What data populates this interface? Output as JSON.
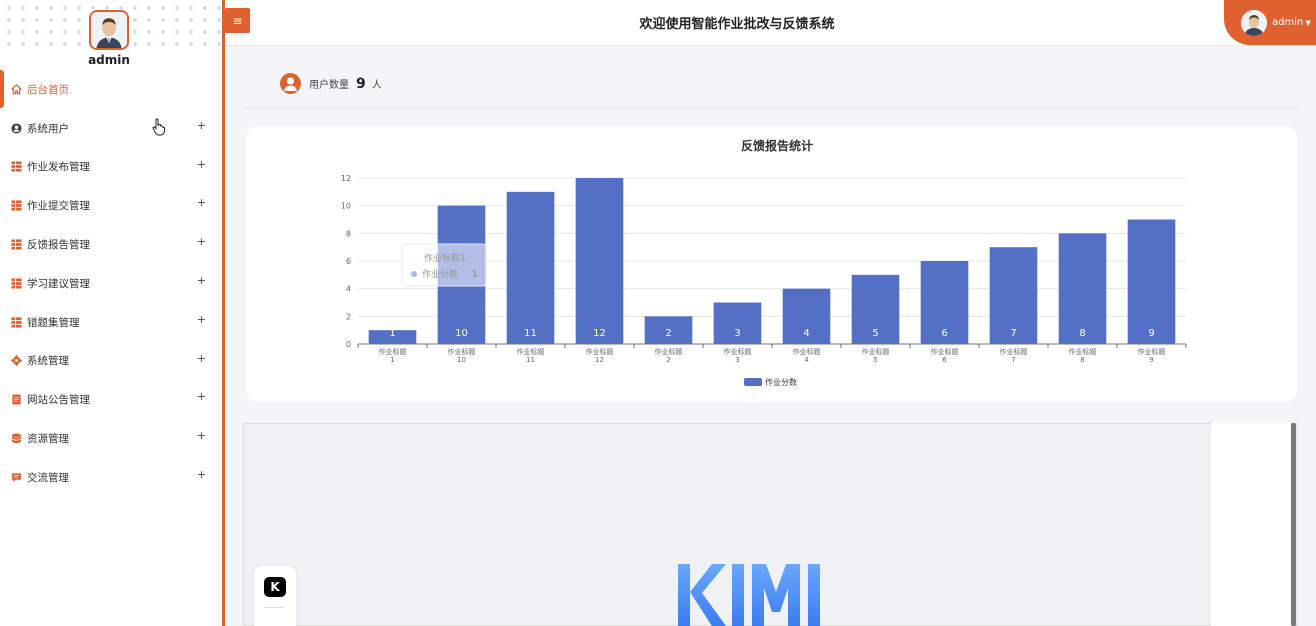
{
  "sidebar": {
    "username": "admin",
    "items": [
      {
        "label": "后台首页",
        "icon": "home-icon",
        "active": true
      },
      {
        "label": "系统用户",
        "icon": "user-circle-icon"
      },
      {
        "label": "作业发布管理",
        "icon": "grid-icon"
      },
      {
        "label": "作业提交管理",
        "icon": "grid-icon"
      },
      {
        "label": "反馈报告管理",
        "icon": "grid-icon"
      },
      {
        "label": "学习建议管理",
        "icon": "grid-icon"
      },
      {
        "label": "错题集管理",
        "icon": "grid-icon"
      },
      {
        "label": "系统管理",
        "icon": "gear-icon"
      },
      {
        "label": "网站公告管理",
        "icon": "document-icon"
      },
      {
        "label": "资源管理",
        "icon": "database-icon"
      },
      {
        "label": "交流管理",
        "icon": "message-icon"
      }
    ],
    "expand_symbol": "+"
  },
  "header": {
    "menu_toggle": "≡",
    "title": "欢迎使用智能作业批改与反馈系统",
    "user": "admin"
  },
  "stats": {
    "label": "用户数量",
    "value": "9",
    "unit": "人"
  },
  "chart_data": {
    "type": "bar",
    "title": "反馈报告统计",
    "categories": [
      "作业标题1",
      "作业标题10",
      "作业标题11",
      "作业标题12",
      "作业标题2",
      "作业标题3",
      "作业标题4",
      "作业标题5",
      "作业标题6",
      "作业标题7",
      "作业标题8",
      "作业标题9"
    ],
    "category_lines": [
      [
        "作业标题",
        "1"
      ],
      [
        "作业标题",
        "10"
      ],
      [
        "作业标题",
        "11"
      ],
      [
        "作业标题",
        "12"
      ],
      [
        "作业标题",
        "2"
      ],
      [
        "作业标题",
        "3"
      ],
      [
        "作业标题",
        "4"
      ],
      [
        "作业标题",
        "5"
      ],
      [
        "作业标题",
        "6"
      ],
      [
        "作业标题",
        "7"
      ],
      [
        "作业标题",
        "8"
      ],
      [
        "作业标题",
        "9"
      ]
    ],
    "series": [
      {
        "name": "作业分数",
        "values": [
          1,
          10,
          11,
          12,
          2,
          3,
          4,
          5,
          6,
          7,
          8,
          9
        ],
        "color": "#5470c6"
      }
    ],
    "yticks": [
      0,
      2,
      4,
      6,
      8,
      10,
      12
    ],
    "ylim": [
      0,
      12
    ],
    "grid": true,
    "legend": "bottom-center",
    "tooltip": {
      "title": "作业标题1",
      "series": "作业分数",
      "value": "1"
    }
  },
  "overlay": {
    "logo_text": "KIMI",
    "side_icon": "K"
  },
  "colors": {
    "accent": "#e0602f",
    "bar": "#5470c6"
  }
}
